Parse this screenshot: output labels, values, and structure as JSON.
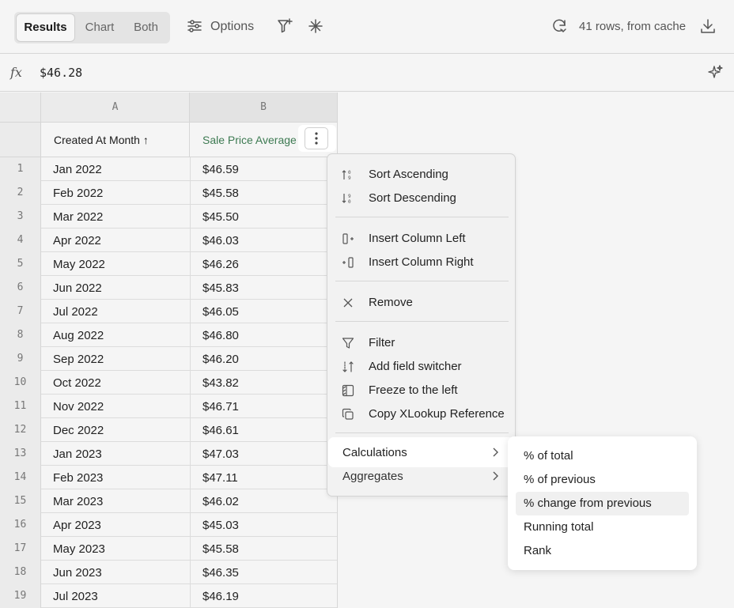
{
  "toolbar": {
    "tabs": [
      {
        "label": "Results",
        "active": true
      },
      {
        "label": "Chart",
        "active": false
      },
      {
        "label": "Both",
        "active": false
      }
    ],
    "options_label": "Options",
    "status_text": "41 rows, from cache"
  },
  "formula_bar": {
    "fx_label": "fx",
    "value": "$46.28"
  },
  "table": {
    "column_letters": [
      "A",
      "B"
    ],
    "headers": [
      "Created At Month ↑",
      "Sale Price Average"
    ],
    "header_b_color": "#3d7a52",
    "rows": [
      {
        "n": "1",
        "a": "Jan 2022",
        "b": "$46.59"
      },
      {
        "n": "2",
        "a": "Feb 2022",
        "b": "$45.58"
      },
      {
        "n": "3",
        "a": "Mar 2022",
        "b": "$45.50"
      },
      {
        "n": "4",
        "a": "Apr 2022",
        "b": "$46.03"
      },
      {
        "n": "5",
        "a": "May 2022",
        "b": "$46.26"
      },
      {
        "n": "6",
        "a": "Jun 2022",
        "b": "$45.83"
      },
      {
        "n": "7",
        "a": "Jul 2022",
        "b": "$46.05"
      },
      {
        "n": "8",
        "a": "Aug 2022",
        "b": "$46.80"
      },
      {
        "n": "9",
        "a": "Sep 2022",
        "b": "$46.20"
      },
      {
        "n": "10",
        "a": "Oct 2022",
        "b": "$43.82"
      },
      {
        "n": "11",
        "a": "Nov 2022",
        "b": "$46.71"
      },
      {
        "n": "12",
        "a": "Dec 2022",
        "b": "$46.61"
      },
      {
        "n": "13",
        "a": "Jan 2023",
        "b": "$47.03"
      },
      {
        "n": "14",
        "a": "Feb 2023",
        "b": "$47.11"
      },
      {
        "n": "15",
        "a": "Mar 2023",
        "b": "$46.02"
      },
      {
        "n": "16",
        "a": "Apr 2023",
        "b": "$45.03"
      },
      {
        "n": "17",
        "a": "May 2023",
        "b": "$45.58"
      },
      {
        "n": "18",
        "a": "Jun 2023",
        "b": "$46.35"
      },
      {
        "n": "19",
        "a": "Jul 2023",
        "b": "$46.19"
      }
    ]
  },
  "context_menu": {
    "items": [
      {
        "label": "Sort Ascending",
        "icon": "sort-ascending-icon"
      },
      {
        "label": "Sort Descending",
        "icon": "sort-descending-icon"
      },
      {
        "label": "Insert Column Left",
        "icon": "insert-column-left-icon"
      },
      {
        "label": "Insert Column Right",
        "icon": "insert-column-right-icon"
      },
      {
        "label": "Remove",
        "icon": "close-icon"
      },
      {
        "label": "Filter",
        "icon": "filter-icon"
      },
      {
        "label": "Add field switcher",
        "icon": "field-switcher-icon"
      },
      {
        "label": "Freeze to the left",
        "icon": "freeze-icon"
      },
      {
        "label": "Copy XLookup Reference",
        "icon": "copy-icon"
      }
    ],
    "calculations_label": "Calculations",
    "aggregates_label": "Aggregates"
  },
  "calculations_submenu": {
    "items": [
      "% of total",
      "% of previous",
      "% change from previous",
      "Running total",
      "Rank"
    ],
    "hovered_index": 2
  }
}
